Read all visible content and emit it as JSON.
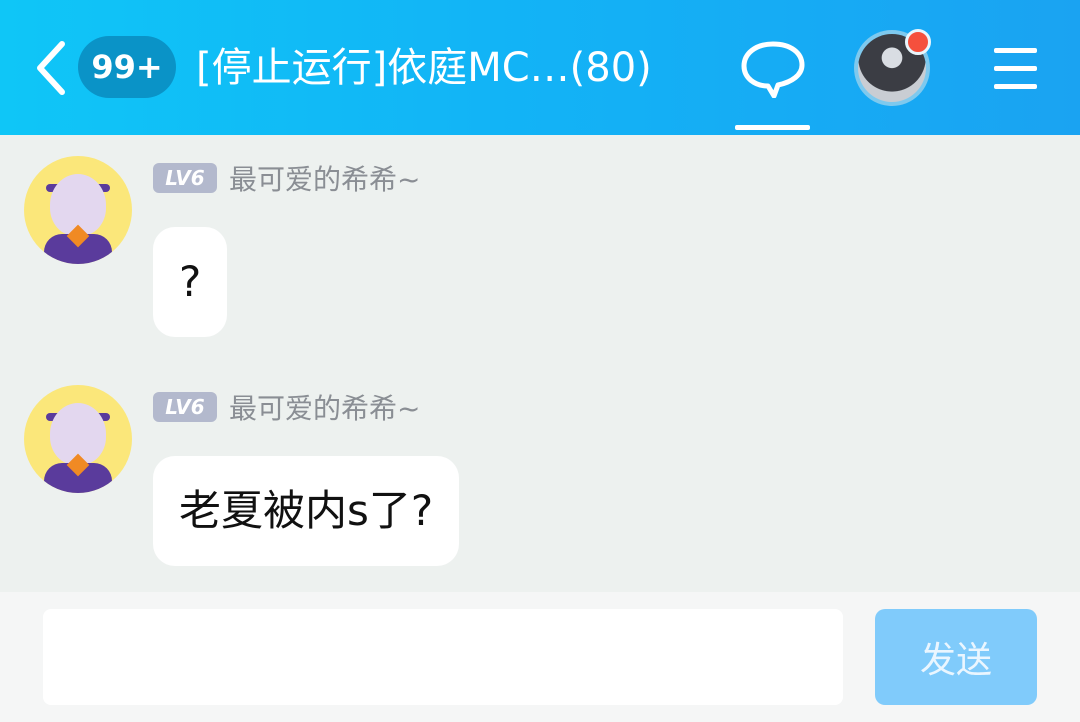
{
  "header": {
    "unread_count": "99+",
    "title": "[停止运行]依庭MC…(80)",
    "menu_icon": "hamburger-icon",
    "chat_icon": "chat-bubble-icon",
    "back_icon": "chevron-left-icon",
    "has_notification": true,
    "accent_color": "#12b4f6",
    "notify_color": "#f5503d"
  },
  "messages": [
    {
      "level": "LV6",
      "sender": "最可爱的希希~",
      "text": "?"
    },
    {
      "level": "LV6",
      "sender": "最可爱的希希~",
      "text": "老夏被内s了?"
    }
  ],
  "input": {
    "value": "",
    "placeholder": "",
    "send_label": "发送",
    "send_color": "#80cbfb"
  }
}
